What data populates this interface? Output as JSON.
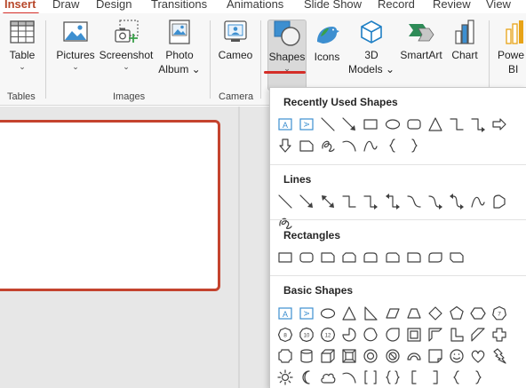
{
  "tabs": [
    {
      "label": "Insert",
      "active": true
    },
    {
      "label": "Draw"
    },
    {
      "label": "Design"
    },
    {
      "label": "Transitions"
    },
    {
      "label": "Animations"
    },
    {
      "label": "Slide Show"
    },
    {
      "label": "Record"
    },
    {
      "label": "Review"
    },
    {
      "label": "View"
    }
  ],
  "ribbon": {
    "groups": {
      "tables": "Tables",
      "images": "Images",
      "camera": "Camera"
    },
    "buttons": {
      "table": "Table",
      "pictures": "Pictures",
      "screenshot": "Screenshot",
      "photo_album_1": "Photo",
      "photo_album_2": "Album",
      "cameo": "Cameo",
      "shapes": "Shapes",
      "icons": "Icons",
      "models_1": "3D",
      "models_2": "Models",
      "smartart": "SmartArt",
      "chart": "Chart",
      "powerbi_1": "Powe",
      "powerbi_2": "BI"
    },
    "accent_color": "#d42d27",
    "tab_active_color": "#b7472a"
  },
  "gallery": {
    "sections": [
      {
        "title": "Recently Used Shapes",
        "icons": [
          "text-box-icon",
          "vertical-text-box-icon",
          "line-icon",
          "line-arrow-icon",
          "rectangle-icon",
          "oval-icon",
          "rounded-rectangle-icon",
          "triangle-icon",
          "elbow-connector-icon",
          "elbow-arrow-connector-icon",
          "right-arrow-icon",
          "down-arrow-icon",
          "snip-rectangle-icon",
          "freeform-scribble-icon",
          "arc-icon",
          "curve-icon",
          "left-brace-icon",
          "right-brace-icon"
        ]
      },
      {
        "title": "Lines",
        "icons": [
          "line-icon",
          "line-arrow-icon",
          "line-double-arrow-icon",
          "elbow-connector-icon",
          "elbow-arrow-connector-icon",
          "elbow-double-arrow-icon",
          "curved-connector-icon",
          "curved-arrow-connector-icon",
          "curved-double-arrow-icon",
          "curve-icon",
          "freeform-shape-icon",
          "freeform-scribble-icon"
        ]
      },
      {
        "title": "Rectangles",
        "icons": [
          "rectangle-icon",
          "rounded-rectangle-icon",
          "snip-single-corner-icon",
          "snip-same-side-icon",
          "round-same-side-icon",
          "snip-round-corner-icon",
          "round-single-corner-icon",
          "round-diagonal-corner-icon",
          "snip-diagonal-corner-icon"
        ]
      },
      {
        "title": "Basic Shapes",
        "icons": [
          "text-box-icon",
          "vertical-text-box-icon",
          "oval-icon",
          "isosceles-triangle-icon",
          "right-triangle-icon",
          "parallelogram-icon",
          "trapezoid-icon",
          "diamond-icon",
          "pentagon-icon",
          "hexagon-icon",
          "heptagon-icon",
          "octagon-icon",
          "decagon-icon",
          "dodecagon-icon",
          "pie-icon",
          "chord-icon",
          "teardrop-icon",
          "frame-icon",
          "half-frame-icon",
          "l-shape-icon",
          "diagonal-stripe-icon",
          "cross-icon",
          "plaque-icon",
          "can-icon",
          "cube-icon",
          "bevel-icon",
          "donut-icon",
          "no-symbol-icon",
          "block-arc-icon",
          "folded-corner-icon",
          "smiley-face-icon",
          "heart-icon",
          "lightning-bolt-icon",
          "sun-icon",
          "moon-icon",
          "cloud-icon",
          "arc-icon",
          "double-bracket-icon",
          "double-brace-icon",
          "left-bracket-icon",
          "right-bracket-icon",
          "left-brace-icon",
          "right-brace-icon"
        ]
      }
    ],
    "polygon_labels": {
      "heptagon": "7",
      "octagon": "8",
      "decagon": "10",
      "dodecagon": "12"
    }
  }
}
